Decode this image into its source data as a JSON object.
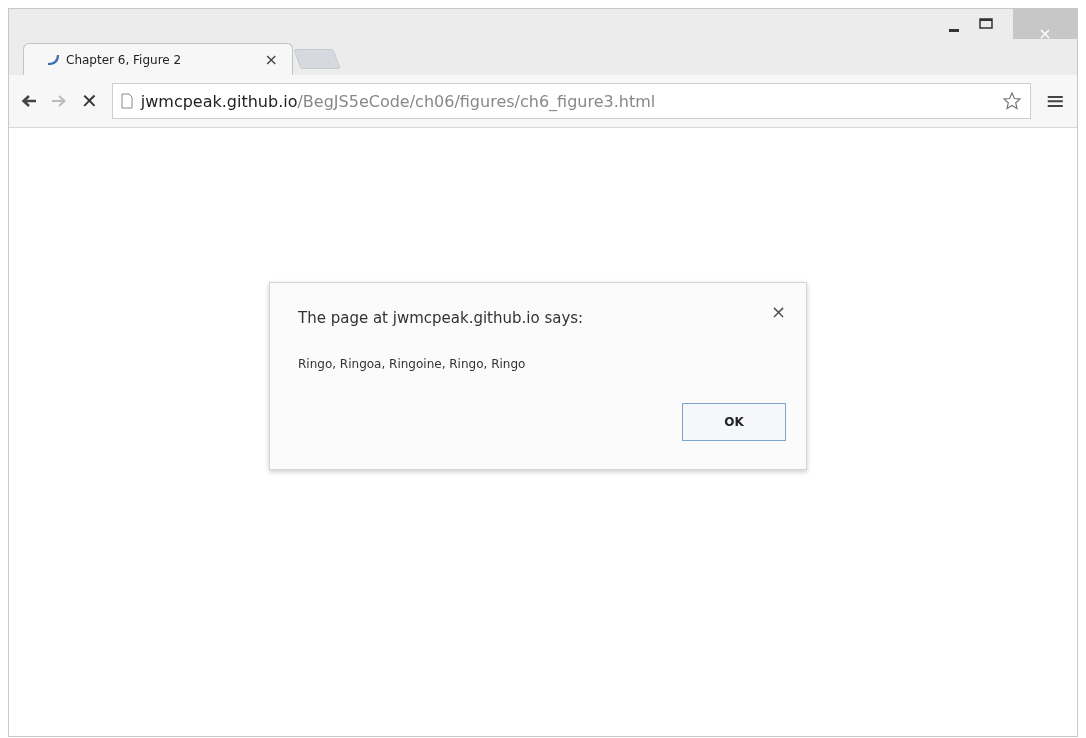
{
  "tabs": [
    {
      "title": "Chapter 6, Figure 2",
      "close": "×",
      "selected": true
    }
  ],
  "toolbar": {
    "stop": "✕",
    "menu": "≡"
  },
  "address": {
    "host": "jwmcpeak.github.io",
    "path": "/BegJS5eCode/ch06/figures/ch6_figure3.html"
  },
  "dialog": {
    "title": "The page at jwmcpeak.github.io says:",
    "close": "×",
    "message": "Ringo, Ringoa, Ringoine, Ringo, Ringo",
    "button": "OK"
  }
}
